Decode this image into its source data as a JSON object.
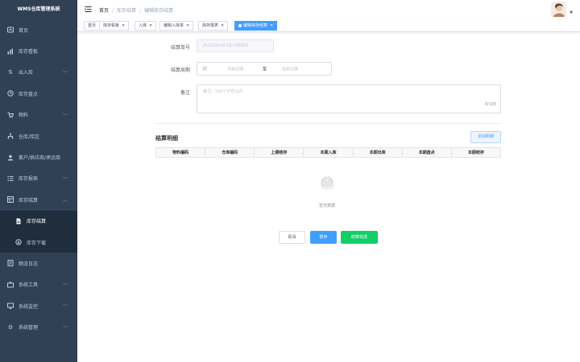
{
  "sidebar": {
    "title": "WMS仓库管理系统",
    "items": [
      {
        "label": "首页",
        "icon": "dashboard-icon"
      },
      {
        "label": "库存看板",
        "icon": "chart-icon"
      },
      {
        "label": "出入库",
        "icon": "swap-icon",
        "arrow": "﹀"
      },
      {
        "label": "库存盘点",
        "icon": "clipboard-icon"
      },
      {
        "label": "物料",
        "icon": "cart-icon",
        "arrow": "﹀"
      },
      {
        "label": "仓库/库区",
        "icon": "tree-icon"
      },
      {
        "label": "客户/供应商/承运商",
        "icon": "user-icon"
      },
      {
        "label": "库存报表",
        "icon": "list-icon",
        "arrow": "﹀"
      },
      {
        "label": "库存结算",
        "icon": "table-icon",
        "arrow": "︿"
      }
    ],
    "submenu": [
      {
        "label": "库存结算",
        "icon": "document-icon"
      },
      {
        "label": "库存下载",
        "icon": "download-icon"
      }
    ],
    "items_after": [
      {
        "label": "物流日志",
        "icon": "log-icon"
      },
      {
        "label": "系统工具",
        "icon": "tool-icon",
        "arrow": "﹀"
      },
      {
        "label": "系统监控",
        "icon": "monitor-icon",
        "arrow": "﹀"
      },
      {
        "label": "系统管理",
        "icon": "settings-icon",
        "arrow": "﹀"
      }
    ]
  },
  "navbar": {
    "breadcrumb": [
      "首页",
      "库存结算",
      "编辑库存结算"
    ],
    "sep": "/"
  },
  "tags": [
    {
      "label": "首页",
      "closable": false
    },
    {
      "label": "库存看板",
      "closable": true
    },
    {
      "label": "入库",
      "closable": true
    },
    {
      "label": "编辑入库单",
      "closable": true
    },
    {
      "label": "库存报表",
      "closable": true
    },
    {
      "label": "编辑库存结算",
      "closable": true,
      "active": true
    }
  ],
  "form": {
    "settle_no_label": "结算单号",
    "settle_no_value": "JS-2024-02-16-145651",
    "period_label": "结算周期",
    "period_start_placeholder": "开始日期",
    "period_to": "至",
    "period_end_placeholder": "结束日期",
    "remark_label": "备注",
    "remark_placeholder": "备注...100个字符以内",
    "remark_counter": "0/100"
  },
  "detail": {
    "title": "结算明细",
    "add_button": "添加明细",
    "columns": [
      "物料编码",
      "仓库编码",
      "上期结存",
      "本期入库",
      "本期出库",
      "本期盘点",
      "本期结存"
    ],
    "empty_text": "暂无数据"
  },
  "actions": {
    "cancel": "取消",
    "save": "暂存",
    "settle": "结算完成"
  },
  "colors": {
    "sidebar_bg": "#304156",
    "accent": "#409eff",
    "success": "#13ce66"
  }
}
